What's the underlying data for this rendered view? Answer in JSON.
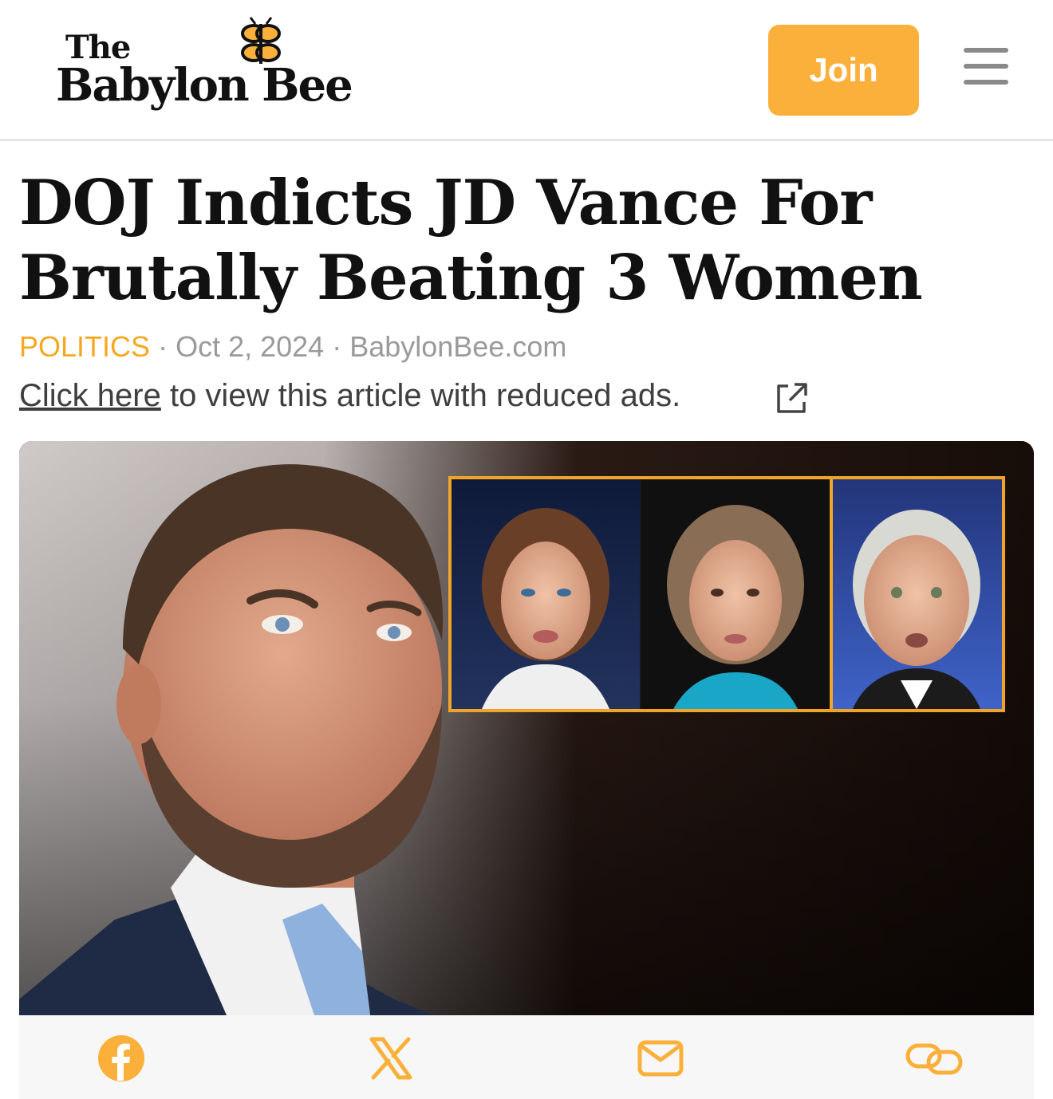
{
  "brand": {
    "logo_top": "The",
    "logo_bottom": "Babylon Bee",
    "accent_color": "#fbb03b"
  },
  "header": {
    "join_label": "Join",
    "menu_icon": "hamburger-menu-icon"
  },
  "article": {
    "headline": "DOJ Indicts JD Vance For Brutally Beating 3 Women",
    "category": "POLITICS",
    "separator": "·",
    "date": "Oct 2, 2024",
    "source": "BabylonBee.com",
    "reduced_ads_link": "Click here",
    "reduced_ads_text": " to view this article with reduced ads.",
    "reduced_ads_icon": "external-link-icon"
  },
  "hero_image": {
    "icon": "article-photo"
  },
  "share": {
    "icons": [
      "facebook-icon",
      "x-icon",
      "email-icon",
      "link-icon"
    ]
  }
}
